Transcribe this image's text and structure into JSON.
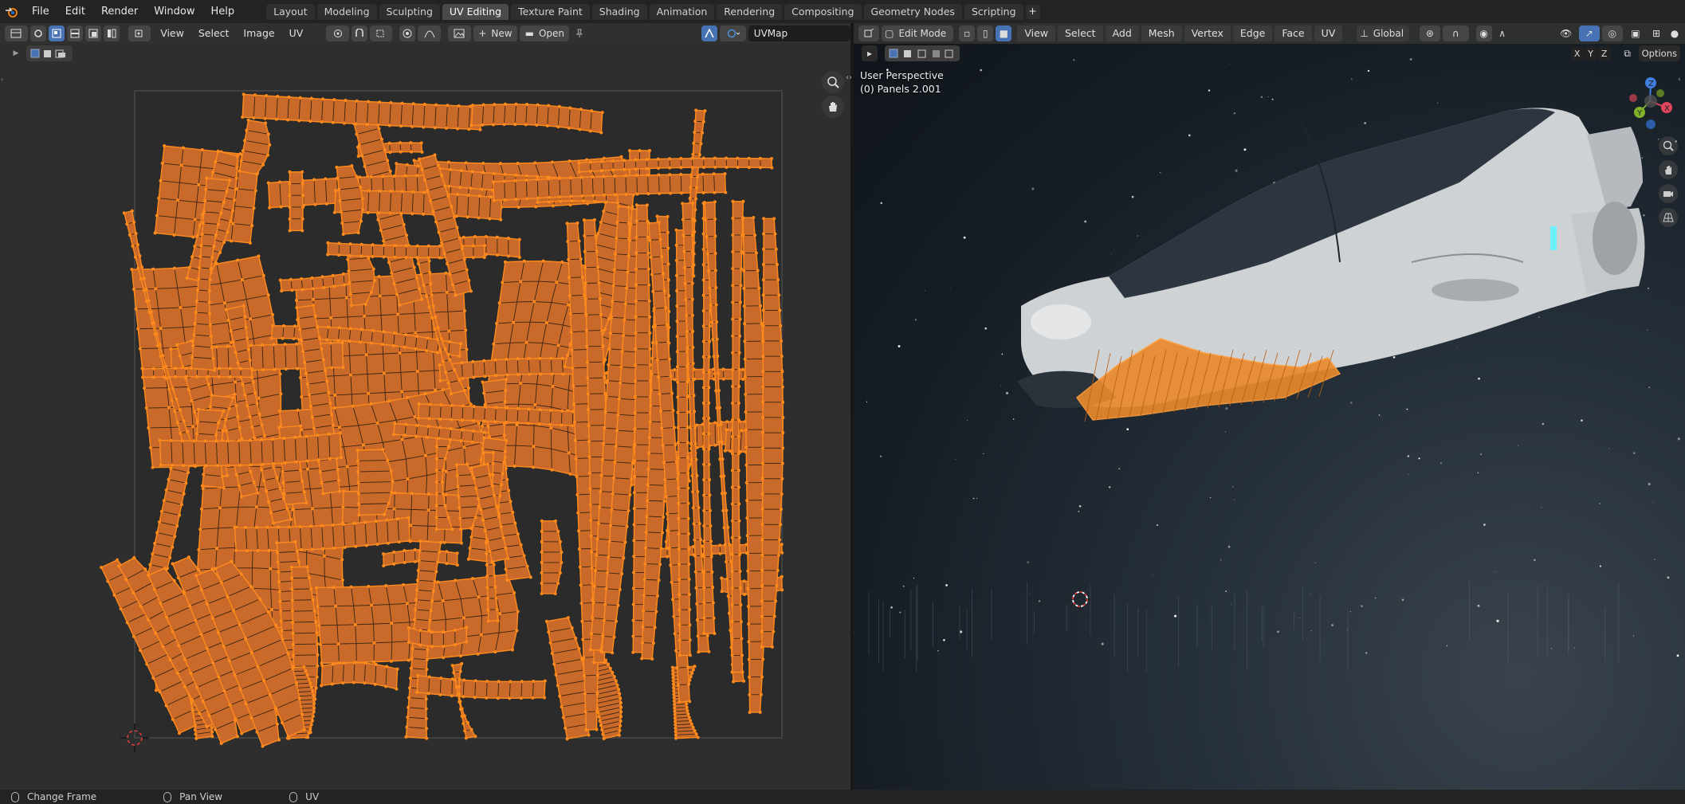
{
  "topbar": {
    "menus": [
      "File",
      "Edit",
      "Render",
      "Window",
      "Help"
    ],
    "workspaces": [
      "Layout",
      "Modeling",
      "Sculpting",
      "UV Editing",
      "Texture Paint",
      "Shading",
      "Animation",
      "Rendering",
      "Compositing",
      "Geometry Nodes",
      "Scripting"
    ],
    "active_workspace": "UV Editing",
    "add_tab": "+"
  },
  "uv_editor": {
    "menus": [
      "View",
      "Select",
      "Image",
      "UV"
    ],
    "new_label": "New",
    "open_label": "Open",
    "uvmap_name": "UVMap",
    "wire_color": "#ff8a1c",
    "face_color": "#c96a2a"
  },
  "viewport": {
    "mode": "Edit Mode",
    "menus": [
      "View",
      "Select",
      "Add",
      "Mesh",
      "Vertex",
      "Edge",
      "Face",
      "UV"
    ],
    "orientation": "Global",
    "overlay_title": "User Perspective",
    "overlay_object": "(0) Panels 2.001",
    "axis_labels": [
      "X",
      "Y",
      "Z"
    ],
    "options_label": "Options",
    "gizmo_axes": {
      "x": "X",
      "y": "Y",
      "z": "Z"
    }
  },
  "statusbar": {
    "items": [
      "Change Frame",
      "Pan View",
      "UV"
    ]
  },
  "colors": {
    "accent": "#4772b3",
    "orange": "#ff8a1c",
    "panel": "#303030"
  }
}
